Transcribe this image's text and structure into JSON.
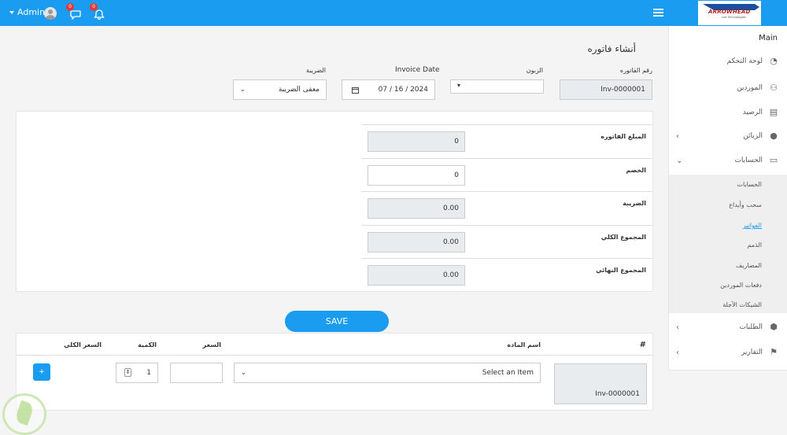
{
  "topbar": {
    "user_label": "Admin",
    "messages_count": "0",
    "notifications_count": "0",
    "logo_text": "ARROWHEAD",
    "logo_subtext": "Lab Technologies"
  },
  "sidebar": {
    "title": "Main",
    "items": [
      {
        "label": "لوحة التحكم",
        "icon": "dashboard-icon"
      },
      {
        "label": "الموردين",
        "icon": "suppliers-icon"
      },
      {
        "label": "الرصيد",
        "icon": "balance-icon"
      },
      {
        "label": "الزبائن",
        "icon": "user-icon"
      },
      {
        "label": "الحسابات",
        "icon": "money-icon"
      },
      {
        "label": "الطلبات",
        "icon": "orders-icon"
      },
      {
        "label": "التقارير",
        "icon": "flag-icon"
      }
    ],
    "submenu": [
      {
        "label": "الحسابات",
        "active": false
      },
      {
        "label": "سحب وأيداع",
        "active": false
      },
      {
        "label": "الفواتير",
        "active": true
      },
      {
        "label": "الذمم",
        "active": false
      },
      {
        "label": "المصاريف",
        "active": false
      },
      {
        "label": "دفعات الموردين",
        "active": false
      },
      {
        "label": "الشيكات الآجلة",
        "active": false
      }
    ]
  },
  "form": {
    "title": "أنشاء فاتوره",
    "invoice_number_label": "رقم الفاتوره",
    "invoice_number": "Inv-0000001",
    "customer_label": "الزبون",
    "customer_value": "",
    "date_label": "Invoice Date",
    "date_value": "07 / 16 / 2024",
    "tax_label": "الضريبة",
    "tax_value": "معفى الضريبة"
  },
  "totals": {
    "invoice_amount_label": "المبلغ الفاتوره",
    "invoice_amount": "0",
    "discount_label": "الخصم",
    "discount": "0",
    "tax_label": "الضريبة",
    "tax": "0.00",
    "total_label": "المجموع الكلي",
    "total": "0.00",
    "final_total_label": "المجموع النهائي",
    "final_total": "0.00"
  },
  "save_label": "SAVE",
  "items_table": {
    "col_number": "#",
    "col_item_name": "اسم الماده",
    "col_price": "السعر",
    "col_qty": "الكمية",
    "col_total": "السعر الكلي",
    "row": {
      "invoice_ref": "Inv-0000001",
      "item_placeholder": "Select an Item",
      "price": "",
      "qty": "1",
      "add_label": "+"
    }
  }
}
